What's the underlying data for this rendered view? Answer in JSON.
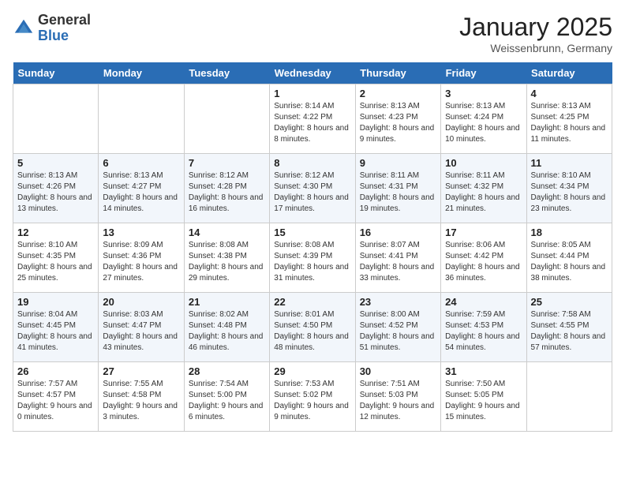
{
  "header": {
    "logo_general": "General",
    "logo_blue": "Blue",
    "title": "January 2025",
    "subtitle": "Weissenbrunn, Germany"
  },
  "weekdays": [
    "Sunday",
    "Monday",
    "Tuesday",
    "Wednesday",
    "Thursday",
    "Friday",
    "Saturday"
  ],
  "weeks": [
    [
      {
        "day": "",
        "info": ""
      },
      {
        "day": "",
        "info": ""
      },
      {
        "day": "",
        "info": ""
      },
      {
        "day": "1",
        "info": "Sunrise: 8:14 AM\nSunset: 4:22 PM\nDaylight: 8 hours\nand 8 minutes."
      },
      {
        "day": "2",
        "info": "Sunrise: 8:13 AM\nSunset: 4:23 PM\nDaylight: 8 hours\nand 9 minutes."
      },
      {
        "day": "3",
        "info": "Sunrise: 8:13 AM\nSunset: 4:24 PM\nDaylight: 8 hours\nand 10 minutes."
      },
      {
        "day": "4",
        "info": "Sunrise: 8:13 AM\nSunset: 4:25 PM\nDaylight: 8 hours\nand 11 minutes."
      }
    ],
    [
      {
        "day": "5",
        "info": "Sunrise: 8:13 AM\nSunset: 4:26 PM\nDaylight: 8 hours\nand 13 minutes."
      },
      {
        "day": "6",
        "info": "Sunrise: 8:13 AM\nSunset: 4:27 PM\nDaylight: 8 hours\nand 14 minutes."
      },
      {
        "day": "7",
        "info": "Sunrise: 8:12 AM\nSunset: 4:28 PM\nDaylight: 8 hours\nand 16 minutes."
      },
      {
        "day": "8",
        "info": "Sunrise: 8:12 AM\nSunset: 4:30 PM\nDaylight: 8 hours\nand 17 minutes."
      },
      {
        "day": "9",
        "info": "Sunrise: 8:11 AM\nSunset: 4:31 PM\nDaylight: 8 hours\nand 19 minutes."
      },
      {
        "day": "10",
        "info": "Sunrise: 8:11 AM\nSunset: 4:32 PM\nDaylight: 8 hours\nand 21 minutes."
      },
      {
        "day": "11",
        "info": "Sunrise: 8:10 AM\nSunset: 4:34 PM\nDaylight: 8 hours\nand 23 minutes."
      }
    ],
    [
      {
        "day": "12",
        "info": "Sunrise: 8:10 AM\nSunset: 4:35 PM\nDaylight: 8 hours\nand 25 minutes."
      },
      {
        "day": "13",
        "info": "Sunrise: 8:09 AM\nSunset: 4:36 PM\nDaylight: 8 hours\nand 27 minutes."
      },
      {
        "day": "14",
        "info": "Sunrise: 8:08 AM\nSunset: 4:38 PM\nDaylight: 8 hours\nand 29 minutes."
      },
      {
        "day": "15",
        "info": "Sunrise: 8:08 AM\nSunset: 4:39 PM\nDaylight: 8 hours\nand 31 minutes."
      },
      {
        "day": "16",
        "info": "Sunrise: 8:07 AM\nSunset: 4:41 PM\nDaylight: 8 hours\nand 33 minutes."
      },
      {
        "day": "17",
        "info": "Sunrise: 8:06 AM\nSunset: 4:42 PM\nDaylight: 8 hours\nand 36 minutes."
      },
      {
        "day": "18",
        "info": "Sunrise: 8:05 AM\nSunset: 4:44 PM\nDaylight: 8 hours\nand 38 minutes."
      }
    ],
    [
      {
        "day": "19",
        "info": "Sunrise: 8:04 AM\nSunset: 4:45 PM\nDaylight: 8 hours\nand 41 minutes."
      },
      {
        "day": "20",
        "info": "Sunrise: 8:03 AM\nSunset: 4:47 PM\nDaylight: 8 hours\nand 43 minutes."
      },
      {
        "day": "21",
        "info": "Sunrise: 8:02 AM\nSunset: 4:48 PM\nDaylight: 8 hours\nand 46 minutes."
      },
      {
        "day": "22",
        "info": "Sunrise: 8:01 AM\nSunset: 4:50 PM\nDaylight: 8 hours\nand 48 minutes."
      },
      {
        "day": "23",
        "info": "Sunrise: 8:00 AM\nSunset: 4:52 PM\nDaylight: 8 hours\nand 51 minutes."
      },
      {
        "day": "24",
        "info": "Sunrise: 7:59 AM\nSunset: 4:53 PM\nDaylight: 8 hours\nand 54 minutes."
      },
      {
        "day": "25",
        "info": "Sunrise: 7:58 AM\nSunset: 4:55 PM\nDaylight: 8 hours\nand 57 minutes."
      }
    ],
    [
      {
        "day": "26",
        "info": "Sunrise: 7:57 AM\nSunset: 4:57 PM\nDaylight: 9 hours\nand 0 minutes."
      },
      {
        "day": "27",
        "info": "Sunrise: 7:55 AM\nSunset: 4:58 PM\nDaylight: 9 hours\nand 3 minutes."
      },
      {
        "day": "28",
        "info": "Sunrise: 7:54 AM\nSunset: 5:00 PM\nDaylight: 9 hours\nand 6 minutes."
      },
      {
        "day": "29",
        "info": "Sunrise: 7:53 AM\nSunset: 5:02 PM\nDaylight: 9 hours\nand 9 minutes."
      },
      {
        "day": "30",
        "info": "Sunrise: 7:51 AM\nSunset: 5:03 PM\nDaylight: 9 hours\nand 12 minutes."
      },
      {
        "day": "31",
        "info": "Sunrise: 7:50 AM\nSunset: 5:05 PM\nDaylight: 9 hours\nand 15 minutes."
      },
      {
        "day": "",
        "info": ""
      }
    ]
  ]
}
